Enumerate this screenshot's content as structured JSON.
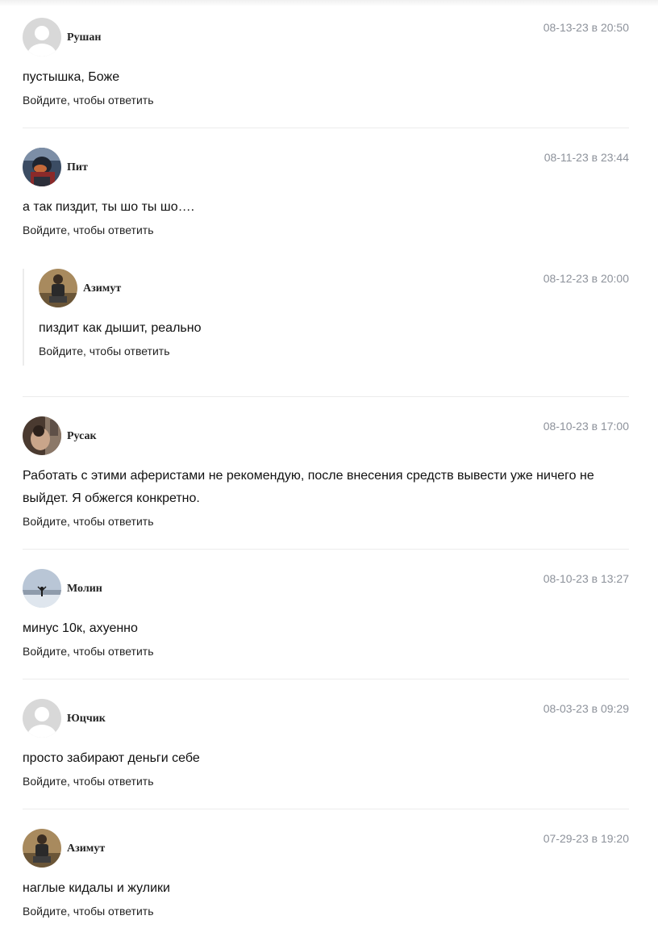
{
  "comments": [
    {
      "author": "Рушан",
      "date": "08-13-23 в 20:50",
      "text": "пустышка, Боже",
      "reply": "Войдите, чтобы ответить",
      "avatar": "default-avatar-icon"
    },
    {
      "author": "Пит",
      "date": "08-11-23 в 23:44",
      "text": "а так пиздит, ты шо ты шо….",
      "reply": "Войдите, чтобы ответить",
      "avatar": "user-photo",
      "replies": [
        {
          "author": "Азимут",
          "date": "08-12-23 в 20:00",
          "text": "пиздит как дышит, реально",
          "reply": "Войдите, чтобы ответить",
          "avatar": "user-photo"
        }
      ]
    },
    {
      "author": "Русак",
      "date": "08-10-23 в 17:00",
      "text": "Работать с этими аферистами не рекомендую, после внесения средств вывести уже ничего не выйдет. Я обжегся конкретно.",
      "reply": "Войдите, чтобы ответить",
      "avatar": "user-photo"
    },
    {
      "author": "Молин",
      "date": "08-10-23 в 13:27",
      "text": "минус 10к, ахуенно",
      "reply": "Войдите, чтобы ответить",
      "avatar": "user-photo"
    },
    {
      "author": "Юцчик",
      "date": "08-03-23 в 09:29",
      "text": "просто забирают деньги себе",
      "reply": "Войдите, чтобы ответить",
      "avatar": "default-avatar-icon"
    },
    {
      "author": "Азимут",
      "date": "07-29-23 в 19:20",
      "text": "наглые кидалы и жулики",
      "reply": "Войдите, чтобы ответить",
      "avatar": "user-photo"
    }
  ]
}
